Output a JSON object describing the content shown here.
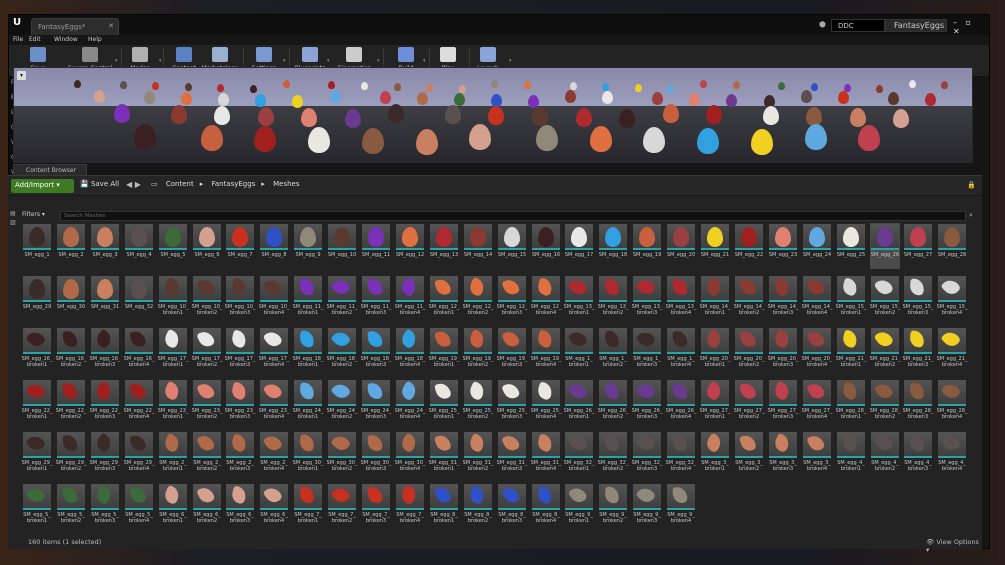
{
  "window": {
    "tab_title": "FantasyEggs*",
    "ddc": "DDC",
    "project": "FantasyEggs",
    "controls": "– ▫ ✕"
  },
  "menu": [
    "File",
    "Edit",
    "Window",
    "Help"
  ],
  "toolbar": [
    {
      "label": "Save Current",
      "icon": "save-icon",
      "color": "#6a8fc9"
    },
    {
      "label": "Source Control",
      "icon": "source-control-icon",
      "color": "#8a8a8a"
    },
    {
      "label": "Modes",
      "icon": "modes-icon",
      "color": "#b0b0b0"
    },
    {
      "label": "Content",
      "icon": "content-icon",
      "color": "#5c82c4"
    },
    {
      "label": "Marketplace",
      "icon": "marketplace-icon",
      "color": "#9ab0d0"
    },
    {
      "label": "Settings",
      "icon": "settings-icon",
      "color": "#7a9ad0"
    },
    {
      "label": "Blueprints",
      "icon": "blueprints-icon",
      "color": "#8aa4d8"
    },
    {
      "label": "Cinematics",
      "icon": "cinematics-icon",
      "color": "#cccccc"
    },
    {
      "label": "Build",
      "icon": "build-icon",
      "color": "#6e8ed8"
    },
    {
      "label": "Play",
      "icon": "play-icon",
      "color": "#dcdcdc"
    },
    {
      "label": "Launch",
      "icon": "launch-icon",
      "color": "#8aa4d8"
    }
  ],
  "left_panel_letters": [
    "Re",
    "Ba",
    "Li",
    "Ci",
    "Vi",
    "Ge",
    "Vo",
    "All"
  ],
  "content_browser": {
    "tab": "Content Browser",
    "add_import": "Add/Import ▾",
    "save_all": "Save All",
    "breadcrumb": [
      "Content",
      "FantasyEggs",
      "Meshes"
    ],
    "filters": "Filters ▾",
    "search_placeholder": "Search Meshes",
    "status": "160 items (1 selected)",
    "view_options": "View Options ▾",
    "selected_asset": "SM_egg_26"
  },
  "rows": [
    [
      "SM_egg_1",
      "SM_egg_2",
      "SM_egg_3",
      "SM_egg_4",
      "SM_egg_5",
      "SM_egg_6",
      "SM_egg_7",
      "SM_egg_8",
      "SM_egg_9",
      "SM_egg_10",
      "SM_egg_11",
      "SM_egg_12",
      "SM_egg_13",
      "SM_egg_14",
      "SM_egg_15",
      "SM_egg_16",
      "SM_egg_17",
      "SM_egg_18",
      "SM_egg_19",
      "SM_egg_20",
      "SM_egg_21",
      "SM_egg_22",
      "SM_egg_23",
      "SM_egg_24",
      "SM_egg_25",
      "SM_egg_26",
      "SM_egg_27",
      "SM_egg_28"
    ],
    [
      "SM_egg_29",
      "SM_egg_30",
      "SM_egg_31",
      "SM_egg_32",
      "SM_egg_10_|broken1",
      "SM_egg_10_|broken2",
      "SM_egg_10_|broken3",
      "SM_egg_10_|broken4",
      "SM_egg_11_|broken1",
      "SM_egg_11_|broken2",
      "SM_egg_11_|broken3",
      "SM_egg_11_|broken4",
      "SM_egg_12_|broken1",
      "SM_egg_12_|broken2",
      "SM_egg_12_|broken3",
      "SM_egg_12_|broken4",
      "SM_egg_13_|broken1",
      "SM_egg_13_|broken2",
      "SM_egg_13_|broken3",
      "SM_egg_13_|broken4",
      "SM_egg_14_|broken1",
      "SM_egg_14_|broken2",
      "SM_egg_14_|broken3",
      "SM_egg_14_|broken4",
      "SM_egg_15_|broken1",
      "SM_egg_15_|broken2",
      "SM_egg_15_|broken3",
      "SM_egg_15_|broken4"
    ],
    [
      "SM_egg_16_|broken1",
      "SM_egg_16_|broken2",
      "SM_egg_16_|broken3",
      "SM_egg_16_|broken4",
      "SM_egg_17_|broken1",
      "SM_egg_17_|broken2",
      "SM_egg_17_|broken3",
      "SM_egg_17_|broken4",
      "SM_egg_18_|broken1",
      "SM_egg_18_|broken2",
      "SM_egg_18_|broken3",
      "SM_egg_18_|broken4",
      "SM_egg_19_|broken1",
      "SM_egg_19_|broken2",
      "SM_egg_19_|broken3",
      "SM_egg_19_|broken4",
      "SM_egg_1_|broken1",
      "SM_egg_1_|broken2",
      "SM_egg_1_|broken3",
      "SM_egg_1_|broken4",
      "SM_egg_20_|broken1",
      "SM_egg_20_|broken2",
      "SM_egg_20_|broken3",
      "SM_egg_20_|broken4",
      "SM_egg_21_|broken1",
      "SM_egg_21_|broken2",
      "SM_egg_21_|broken3",
      "SM_egg_21_|broken4"
    ],
    [
      "SM_egg_22_|broken1",
      "SM_egg_22_|broken2",
      "SM_egg_22_|broken3",
      "SM_egg_22_|broken4",
      "SM_egg_23_|broken1",
      "SM_egg_23_|broken2",
      "SM_egg_23_|broken3",
      "SM_egg_23_|broken4",
      "SM_egg_24_|broken1",
      "SM_egg_24_|broken2",
      "SM_egg_24_|broken3",
      "SM_egg_24_|broken4",
      "SM_egg_25_|broken1",
      "SM_egg_25_|broken2",
      "SM_egg_25_|broken3",
      "SM_egg_25_|broken4",
      "SM_egg_26_|broken1",
      "SM_egg_26_|broken2",
      "SM_egg_26_|broken3",
      "SM_egg_26_|broken4",
      "SM_egg_27_|broken1",
      "SM_egg_27_|broken2",
      "SM_egg_27_|broken3",
      "SM_egg_27_|broken4",
      "SM_egg_28_|broken1",
      "SM_egg_28_|broken2",
      "SM_egg_28_|broken3",
      "SM_egg_28_|broken4"
    ],
    [
      "SM_egg_29_|broken1",
      "SM_egg_29_|broken2",
      "SM_egg_29_|broken3",
      "SM_egg_29_|broken4",
      "SM_egg_2_|broken1",
      "SM_egg_2_|broken2",
      "SM_egg_2_|broken3",
      "SM_egg_2_|broken4",
      "SM_egg_30_|broken1",
      "SM_egg_30_|broken2",
      "SM_egg_30_|broken3",
      "SM_egg_30_|broken4",
      "SM_egg_31_|broken1",
      "SM_egg_31_|broken2",
      "SM_egg_31_|broken3",
      "SM_egg_31_|broken4",
      "SM_egg_32_|broken1",
      "SM_egg_32_|broken2",
      "SM_egg_32_|broken3",
      "SM_egg_32_|broken4",
      "SM_egg_3_|broken1",
      "SM_egg_3_|broken2",
      "SM_egg_3_|broken3",
      "SM_egg_3_|broken4",
      "SM_egg_4_|broken1",
      "SM_egg_4_|broken2",
      "SM_egg_4_|broken3",
      "SM_egg_4_|broken4"
    ],
    [
      "SM_egg_5_|broken1",
      "SM_egg_5_|broken2",
      "SM_egg_5_|broken3",
      "SM_egg_5_|broken4",
      "SM_egg_6_|broken1",
      "SM_egg_6_|broken2",
      "SM_egg_6_|broken3",
      "SM_egg_6_|broken4",
      "SM_egg_7_|broken1",
      "SM_egg_7_|broken2",
      "SM_egg_7_|broken3",
      "SM_egg_7_|broken4",
      "SM_egg_8_|broken1",
      "SM_egg_8_|broken2",
      "SM_egg_8_|broken3",
      "SM_egg_8_|broken4",
      "SM_egg_9_|broken1",
      "SM_egg_9_|broken2",
      "SM_egg_9_|broken3",
      "SM_egg_9_|broken4"
    ]
  ],
  "egg_colors": [
    "#3a2a28",
    "#b06a4a",
    "#c98060",
    "#5a5050",
    "#3d6a3a",
    "#d4a090",
    "#c83020",
    "#3050c8",
    "#908878",
    "#5a3a30",
    "#7a30b8",
    "#e07040",
    "#b02830",
    "#8a3a30",
    "#d8d8d8",
    "#3a2020",
    "#e8e8e8",
    "#30a0e0",
    "#c86040",
    "#9a4040",
    "#f0d020",
    "#a02020",
    "#e08070",
    "#60a8e0",
    "#e8e8e0",
    "#6a3a90",
    "#c04050",
    "#8a5a40"
  ],
  "colors": {
    "accent_green": "#3e7a24",
    "thumb_stripe": "#29a2a8",
    "selected": "#4b4b4b"
  }
}
